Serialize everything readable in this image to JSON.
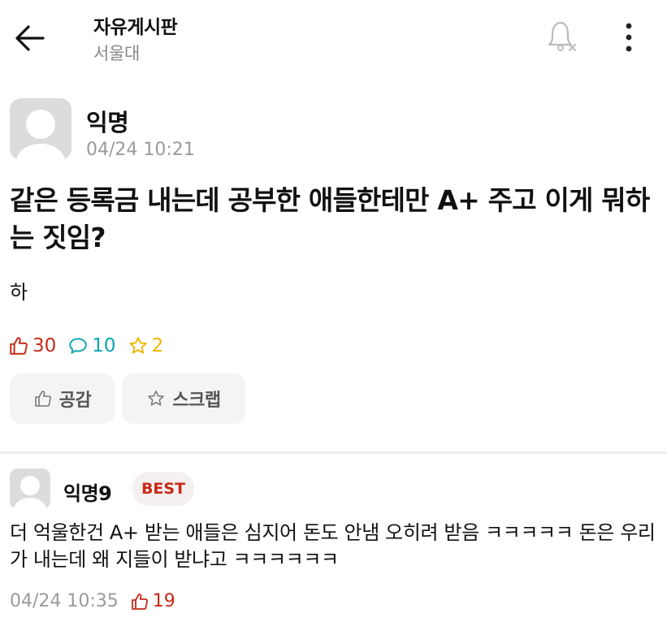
{
  "header": {
    "board_title": "자유게시판",
    "board_sub": "서울대",
    "icons": [
      "arrow-left-icon",
      "bell-off-icon",
      "more-vertical-icon"
    ]
  },
  "post": {
    "author": "익명",
    "time": "04/24 10:21",
    "title": "같은 등록금 내는데 공부한 애들한테만 A+ 주고 이게 뭐하는 짓임?",
    "body": "하",
    "stats": {
      "likes": "30",
      "comments": "10",
      "scraps": "2"
    },
    "buttons": {
      "like_label": "공감",
      "scrap_label": "스크랩"
    }
  },
  "comment": {
    "author": "익명9",
    "badge": "BEST",
    "body": "더 억울한건 A+ 받는 애들은 심지어 돈도 안냄 오히려 받음 ㅋㅋㅋㅋㅋ 돈은 우리가 내는데 왜 지들이 받냐고 ㅋㅋㅋㅋㅋㅋ",
    "time": "04/24 10:35",
    "likes": "19"
  },
  "colors": {
    "like": "#c62917",
    "comment": "#0ca5b0",
    "scrap": "#f0b400",
    "muted": "#9a9a9a"
  }
}
